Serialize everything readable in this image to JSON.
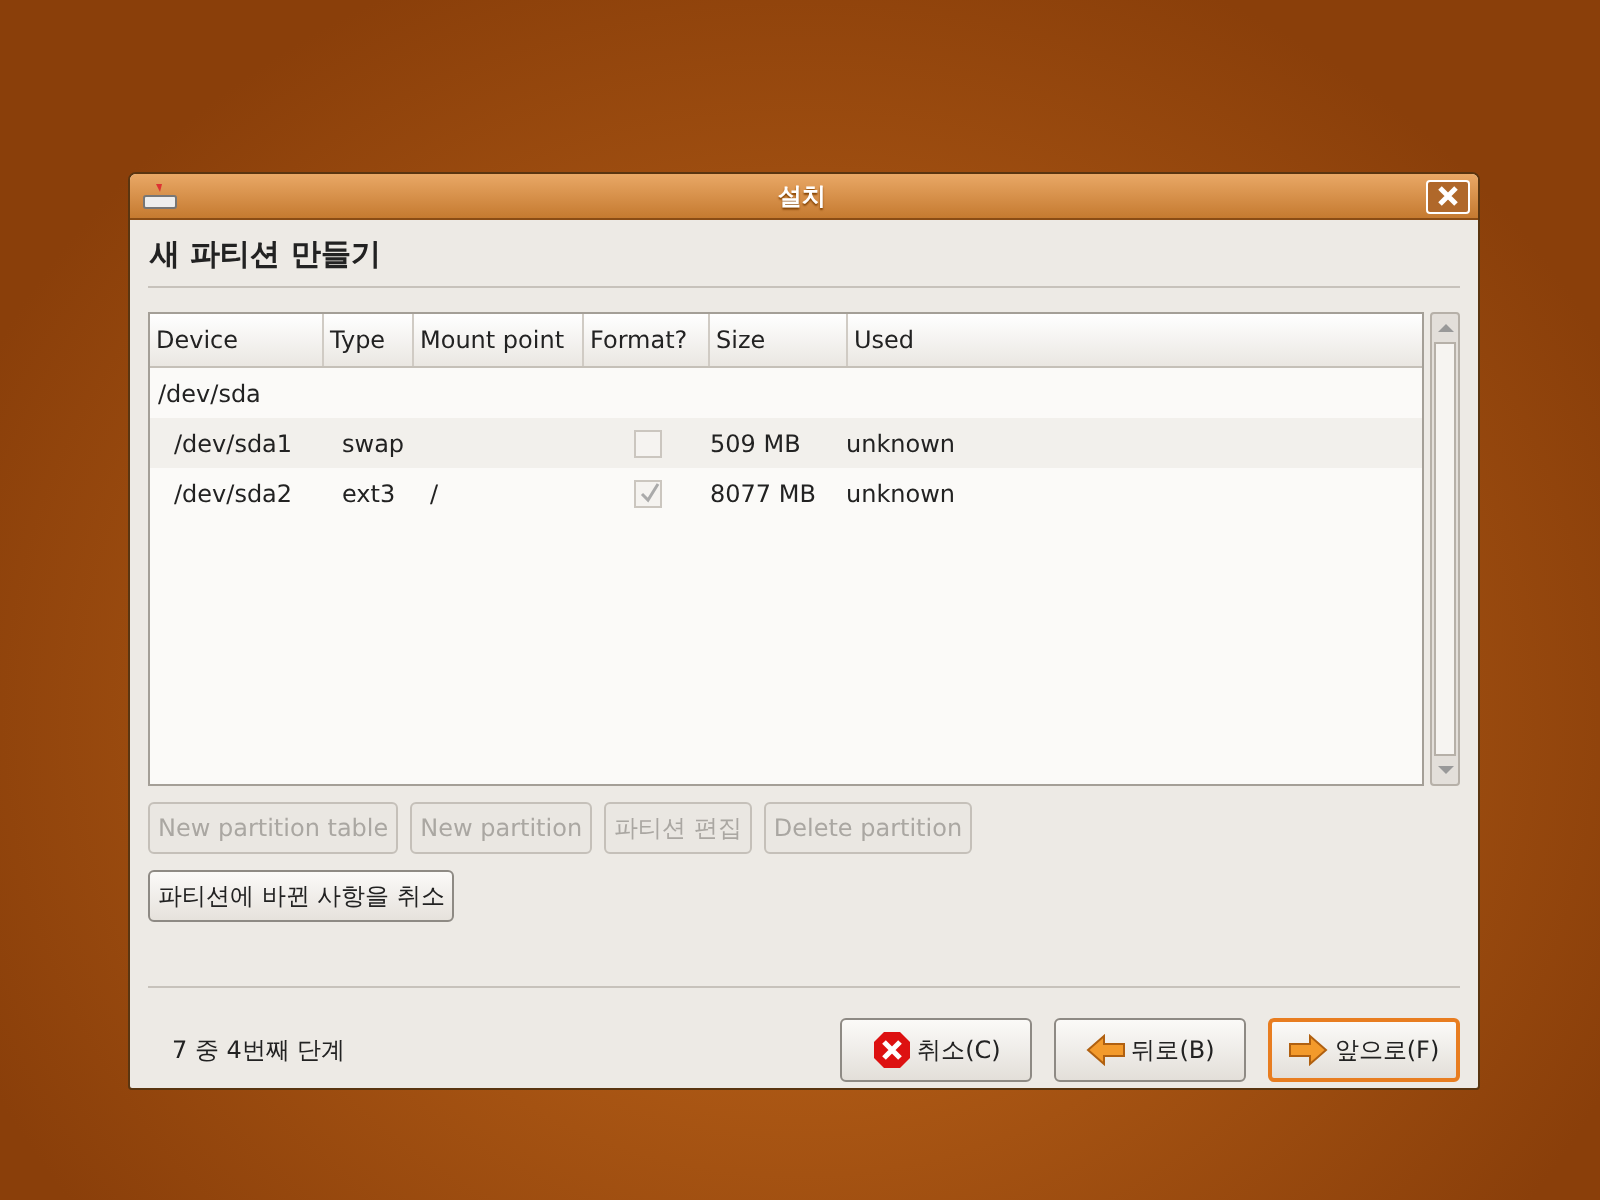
{
  "window": {
    "title": "설치"
  },
  "heading": "새 파티션 만들기",
  "table": {
    "columns": [
      "Device",
      "Type",
      "Mount point",
      "Format?",
      "Size",
      "Used"
    ],
    "rows": [
      {
        "device": "/dev/sda",
        "children": [
          {
            "device": "/dev/sda1",
            "type": "swap",
            "format": {
              "checked": false,
              "disabled": true
            },
            "size": "509 MB",
            "used": "unknown"
          },
          {
            "device": "/dev/sda2",
            "type": "ext3",
            "mount": "/",
            "format": {
              "checked": true,
              "disabled": true
            },
            "size": "8077 MB",
            "used": "unknown"
          }
        ]
      }
    ]
  },
  "partition_buttons": [
    {
      "label": "New partition table",
      "disabled": true
    },
    {
      "label": "New partition",
      "disabled": true
    },
    {
      "label": "파티션 편집",
      "disabled": true
    },
    {
      "label": "Delete partition",
      "disabled": true
    }
  ],
  "undo_button": {
    "label": "파티션에 바뀐 사항을 취소",
    "disabled": false
  },
  "step": "7 중 4번째 단계",
  "nav_buttons": [
    {
      "kind": "cancel",
      "label": "취소(C)",
      "focused": false
    },
    {
      "kind": "back",
      "label": "뒤로(B)",
      "focused": false
    },
    {
      "kind": "forward",
      "label": "앞으로(F)",
      "focused": true
    }
  ]
}
